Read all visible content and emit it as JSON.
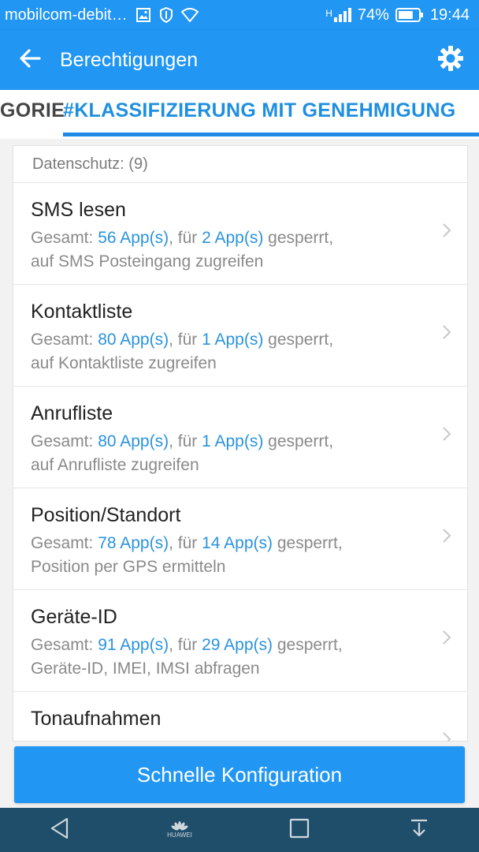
{
  "status_bar": {
    "carrier": "mobilcom-debit…",
    "network": "H",
    "battery_percent": "74%",
    "battery_level": 0.74,
    "time": "19:44"
  },
  "app_bar": {
    "title": "Berechtigungen",
    "back_icon": "arrow-left-icon",
    "settings_icon": "gear-icon"
  },
  "tabs": {
    "previous_partial": "GORIE",
    "active": "#KLASSIFIZIERUNG MIT GENEHMIGUNG"
  },
  "section": {
    "header": "Datenschutz: (9)"
  },
  "permissions": [
    {
      "title": "SMS lesen",
      "prefix": "Gesamt: ",
      "total": "56 App(s)",
      "mid": ", für ",
      "blocked": "2 App(s)",
      "suffix": " gesperrt,",
      "desc": "auf SMS Posteingang zugreifen"
    },
    {
      "title": "Kontaktliste",
      "prefix": "Gesamt: ",
      "total": "80 App(s)",
      "mid": ", für ",
      "blocked": "1 App(s)",
      "suffix": " gesperrt,",
      "desc": "auf Kontaktliste zugreifen"
    },
    {
      "title": "Anrufliste",
      "prefix": "Gesamt: ",
      "total": "80 App(s)",
      "mid": ", für ",
      "blocked": "1 App(s)",
      "suffix": " gesperrt,",
      "desc": "auf Anrufliste zugreifen"
    },
    {
      "title": "Position/Standort",
      "prefix": "Gesamt: ",
      "total": "78 App(s)",
      "mid": ", für ",
      "blocked": "14 App(s)",
      "suffix": " gesperrt,",
      "desc": "Position per GPS ermitteln"
    },
    {
      "title": "Geräte-ID",
      "prefix": "Gesamt: ",
      "total": "91 App(s)",
      "mid": ", für ",
      "blocked": "29 App(s)",
      "suffix": " gesperrt,",
      "desc": "Geräte-ID, IMEI, IMSI abfragen"
    },
    {
      "title": "Tonaufnahmen"
    }
  ],
  "bottom_button": {
    "label": "Schnelle Konfiguration"
  },
  "nav_bar": {
    "brand": "HUAWEI"
  },
  "colors": {
    "primary": "#2196f3",
    "highlight": "#2a93dd",
    "nav_bar": "#1f4e6b"
  }
}
